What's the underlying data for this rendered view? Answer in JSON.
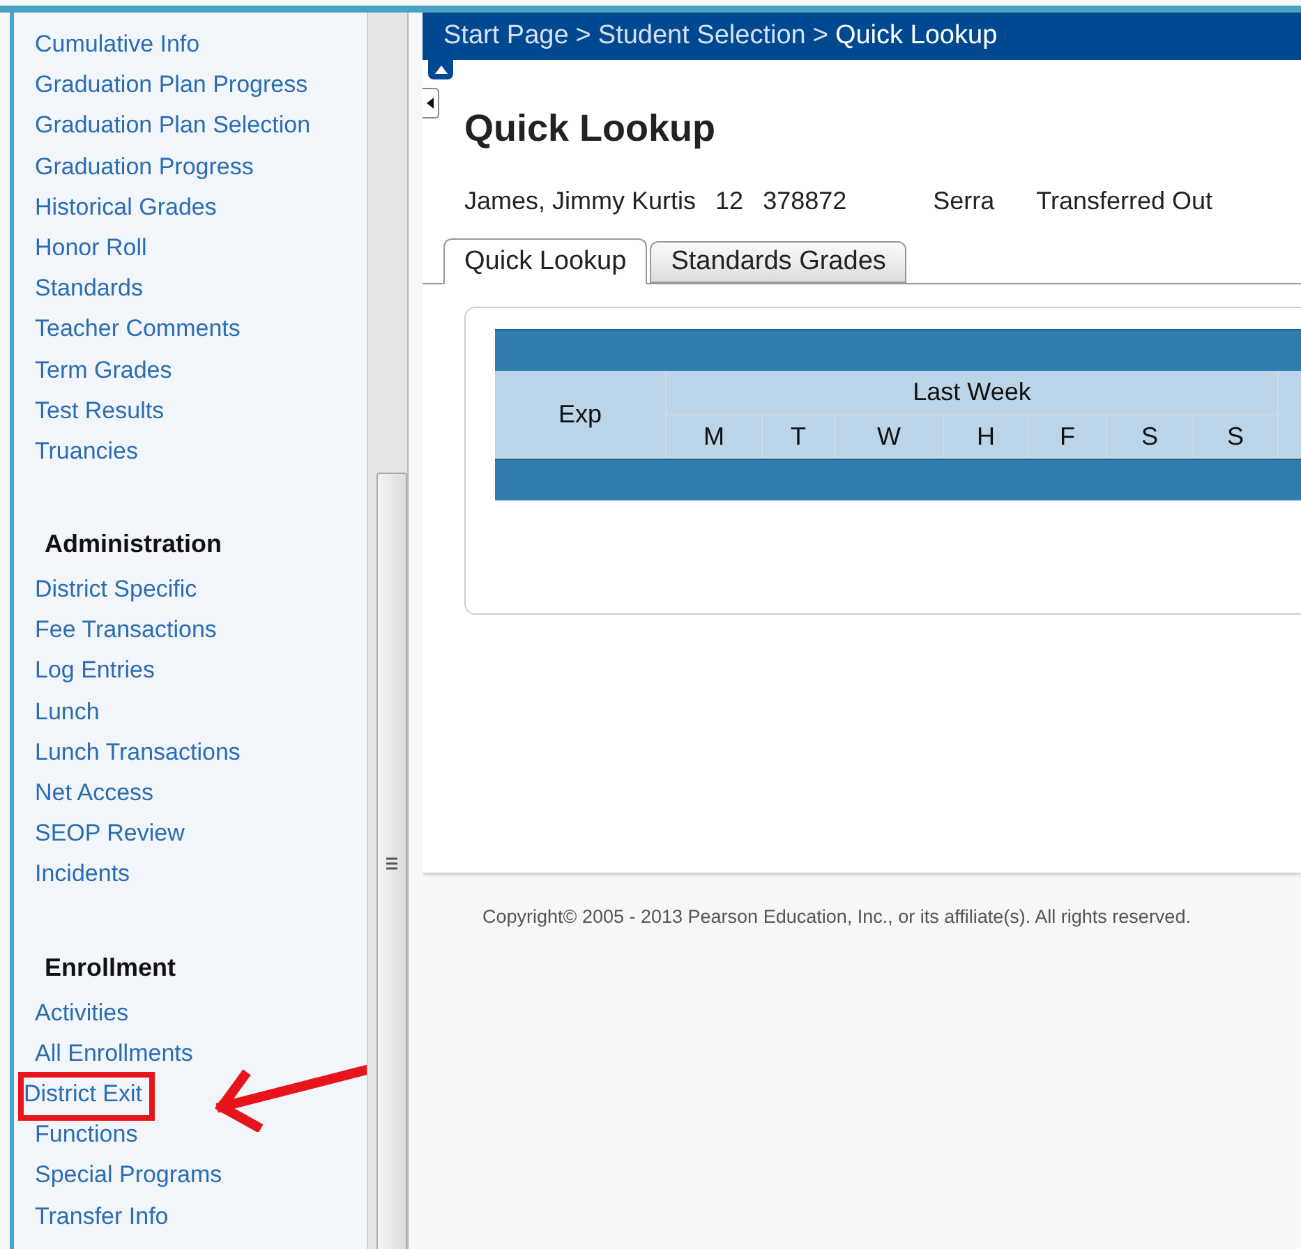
{
  "sidebar": {
    "sections": [
      {
        "items": [
          {
            "label": "Cumulative Info",
            "annotated": false
          },
          {
            "label": "Graduation Plan Progress",
            "annotated": false
          },
          {
            "label": "Graduation Plan Selection",
            "annotated": false
          },
          {
            "label": "Graduation Progress",
            "annotated": false
          },
          {
            "label": "Historical Grades",
            "annotated": false
          },
          {
            "label": "Honor Roll",
            "annotated": false
          },
          {
            "label": "Standards",
            "annotated": false
          },
          {
            "label": "Teacher Comments",
            "annotated": false
          },
          {
            "label": "Term Grades",
            "annotated": false
          },
          {
            "label": "Test Results",
            "annotated": false
          },
          {
            "label": "Truancies",
            "annotated": false
          }
        ]
      },
      {
        "heading": "Administration",
        "items": [
          {
            "label": "District Specific",
            "annotated": false
          },
          {
            "label": "Fee Transactions",
            "annotated": false
          },
          {
            "label": "Log Entries",
            "annotated": false
          },
          {
            "label": "Lunch",
            "annotated": false
          },
          {
            "label": "Lunch Transactions",
            "annotated": false
          },
          {
            "label": "Net Access",
            "annotated": false
          },
          {
            "label": "SEOP Review",
            "annotated": false
          },
          {
            "label": "Incidents",
            "annotated": false
          }
        ]
      },
      {
        "heading": "Enrollment",
        "items": [
          {
            "label": "Activities",
            "annotated": false
          },
          {
            "label": "All Enrollments",
            "annotated": false
          },
          {
            "label": "District Exit",
            "annotated": true
          },
          {
            "label": "Functions",
            "annotated": false
          },
          {
            "label": "Special Programs",
            "annotated": false
          },
          {
            "label": "Transfer Info",
            "annotated": false
          }
        ]
      }
    ]
  },
  "breadcrumb": [
    "Start Page",
    "Student Selection",
    "Quick Lookup"
  ],
  "breadcrumb_separator": ">",
  "page_title": "Quick Lookup",
  "student": {
    "name": "James, Jimmy Kurtis",
    "grade": "12",
    "id": "378872",
    "school": "Serra",
    "status": "Transferred Out"
  },
  "tabs": [
    {
      "label": "Quick Lookup",
      "selected": true
    },
    {
      "label": "Standards Grades",
      "selected": false
    }
  ],
  "table": {
    "first_column": "Exp",
    "group": "Last Week",
    "days": [
      "M",
      "T",
      "W",
      "H",
      "F",
      "S",
      "S"
    ]
  },
  "footer": "Copyright© 2005 - 2013 Pearson Education, Inc., or its affiliate(s). All rights reserved."
}
